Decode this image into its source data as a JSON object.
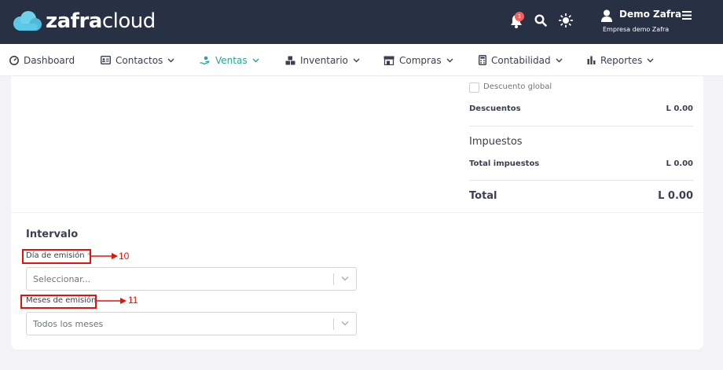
{
  "header": {
    "logo_word_bold": "zafra",
    "logo_word_light": "cloud",
    "notification_count": "1",
    "user_name": "Demo Zafra",
    "company_name": "Empresa demo Zafra"
  },
  "nav": {
    "items": [
      {
        "label": "Dashboard",
        "icon": "dashboard-icon",
        "has_dropdown": false
      },
      {
        "label": "Contactos",
        "icon": "contacts-card-icon",
        "has_dropdown": true
      },
      {
        "label": "Ventas",
        "icon": "sales-hand-icon",
        "has_dropdown": true,
        "active": true
      },
      {
        "label": "Inventario",
        "icon": "boxes-icon",
        "has_dropdown": true
      },
      {
        "label": "Compras",
        "icon": "store-icon",
        "has_dropdown": true
      },
      {
        "label": "Contabilidad",
        "icon": "calculator-icon",
        "has_dropdown": true
      },
      {
        "label": "Reportes",
        "icon": "bar-chart-icon",
        "has_dropdown": true
      }
    ],
    "active_color": "#26a69a"
  },
  "summary": {
    "descuento_global_label": "Descuento global",
    "descuento_global_checked": false,
    "descuentos_label": "Descuentos",
    "descuentos_value": "L 0.00",
    "impuestos_heading": "Impuestos",
    "total_impuestos_label": "Total impuestos",
    "total_impuestos_value": "L 0.00",
    "total_label": "Total",
    "total_value": "L 0.00"
  },
  "intervalo": {
    "heading": "Intervalo",
    "dia_emision_label": "Día de emisión",
    "dia_emision_required_mark": "*",
    "dia_emision_placeholder": "Seleccionar...",
    "meses_emision_label": "Meses de emisión",
    "meses_emision_value": "Todos los meses"
  },
  "annotations": {
    "dia_emision_marker": "10",
    "meses_emision_marker": "11",
    "color": "#e3120b"
  },
  "colors": {
    "header_bg": "#283043",
    "logo_cloud": "#5bc8e6"
  }
}
